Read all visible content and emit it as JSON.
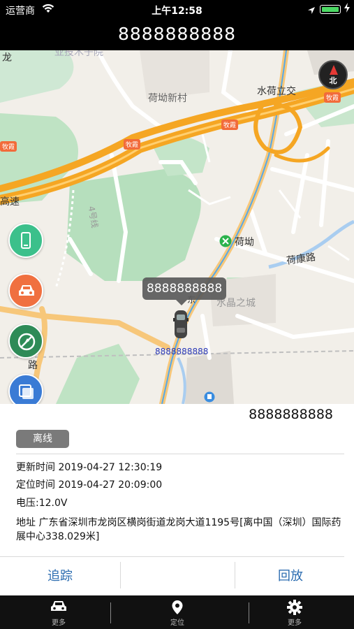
{
  "status_bar": {
    "carrier": "运营商",
    "time": "上午12:58"
  },
  "header": {
    "title": "8888888888"
  },
  "map": {
    "labels": {
      "area_faded": "亚投木子院",
      "hekeng_village": "荷坳新村",
      "shuihe_interchange": "水荷立交",
      "hekeng_station": "荷坳",
      "hekang_road": "荷康路",
      "crystal_city": "水晶之城",
      "expressway_gao": "高速",
      "expressway_su": "速",
      "road_4": "4号线",
      "road_lu": "路",
      "road_dong": "东",
      "road_long": "龙"
    },
    "road_badge": "牧霞",
    "compass_label": "北",
    "vehicle_bubble": "8888888888",
    "vehicle_label": "8888888888"
  },
  "panel": {
    "plate": "8888888888",
    "status": "离线",
    "update_time": "更新时间 2019-04-27 12:30:19",
    "position_time": "定位时间 2019-04-27 20:09:00",
    "voltage": "电压:12.0V",
    "address": "地址 广东省深圳市龙岗区横岗街道龙岗大道1195号[离中国（深圳）国际药展中心338.029米]",
    "track_label": "追踪",
    "playback_label": "回放"
  },
  "tabbar": {
    "tabs": [
      {
        "label": "更多"
      },
      {
        "label": "定位"
      },
      {
        "label": "更多"
      }
    ]
  },
  "colors": {
    "expressway": "#f5a623",
    "status_offline": "#7a7a7a",
    "action_text": "#2b6cb0",
    "phone_btn": "#3cc08b",
    "car_btn": "#f07040",
    "fence_btn": "#2e8b57",
    "layers_btn": "#3a7bd5"
  }
}
